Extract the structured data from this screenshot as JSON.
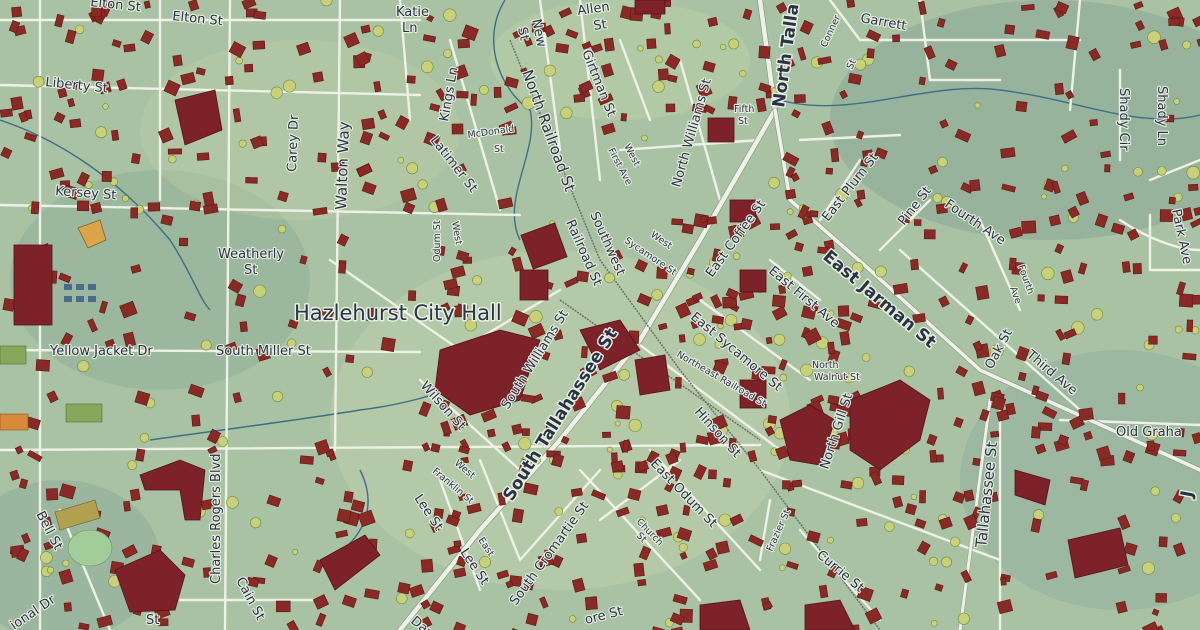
{
  "map": {
    "place_label": "Hazlehurst City Hall",
    "colors": {
      "terrain": "#a9c2a4",
      "road": "#eef1e6",
      "building": "#8a2a26",
      "stream": "#3d6f86",
      "label": "#2a3344"
    },
    "streets": {
      "elton": "Elton St",
      "elton2": "Elton St",
      "katie": "Katie",
      "katie_ln": "Ln",
      "allen": "Allen",
      "allen_st": "St",
      "new": "New",
      "new_st": "St",
      "garrett": "Garrett",
      "conner": "Conner",
      "conner_st": "St",
      "north_talla": "North Talla",
      "liberty": "Liberty St",
      "kings_ln": "Kings Ln",
      "girtman": "Girtman St",
      "north_railroad": "North Railroad St",
      "north_williams": "North Williams St",
      "fifth": "Fifth",
      "fifth_st": "St",
      "shady_cir": "Shady Cir",
      "shady_ln": "Shady Ln",
      "mcdonald": "McDonald",
      "mcdonald_st": "St",
      "carey_dr": "Carey Dr",
      "walton_way": "Walton Way",
      "latimer": "Latimer St",
      "west_first": "West",
      "west_first_ave": "First Ave",
      "kersey": "Kersey St",
      "east_plum": "East Plum St",
      "pine": "Pine St",
      "fourth_ave": "Fourth Ave",
      "park_ave": "Park Ave",
      "east_coffee": "East Coffee St",
      "west_sycamore": "West",
      "west_sycamore_st": "Sycamore St",
      "odum": "Odum St",
      "west_odum": "West",
      "weatherly": "Weatherly",
      "weatherly_st": "St",
      "railroad": "Railroad St",
      "southwest": "Southwest",
      "east_first_ave": "East First Ave",
      "east_jarman": "East Jarman St",
      "fourth": "Fourth",
      "fourth_ave2": "Ave",
      "yellow_jacket": "Yellow Jacket Dr",
      "south_miller": "South Miller St",
      "east_sycamore": "East Sycamore St",
      "south_williams": "South Williams St",
      "south_tallahassee": "South Tallahassee St",
      "northeast_railroad": "Northeast Railroad St",
      "north": "North",
      "walnut": "Walnut St",
      "oak": "Oak St",
      "third_ave": "Third Ave",
      "wilson": "Wilson St",
      "hinson": "Hinson St",
      "north_gill": "North Gill St",
      "tallahassee": "Tallahassee St",
      "old_graham": "Old Graha",
      "charles_rogers": "Charles Rogers Blvd",
      "west_franklin": "West",
      "west_franklin_st": "Franklin St",
      "east_odum": "East Odum St",
      "lee": "Lee St",
      "lee2": "Lee St",
      "east_lee": "East",
      "south_cromartie": "South Cromartie St",
      "church": "Church",
      "church_st": "St",
      "frazier": "Frazier St",
      "currie": "Currie St",
      "bell": "Bell St",
      "cain": "Cain St",
      "national_dr": "ional Dr",
      "st_bottom": "St",
      "dav": "Dav",
      "ore": "ore St",
      "j_edge": "J"
    }
  }
}
